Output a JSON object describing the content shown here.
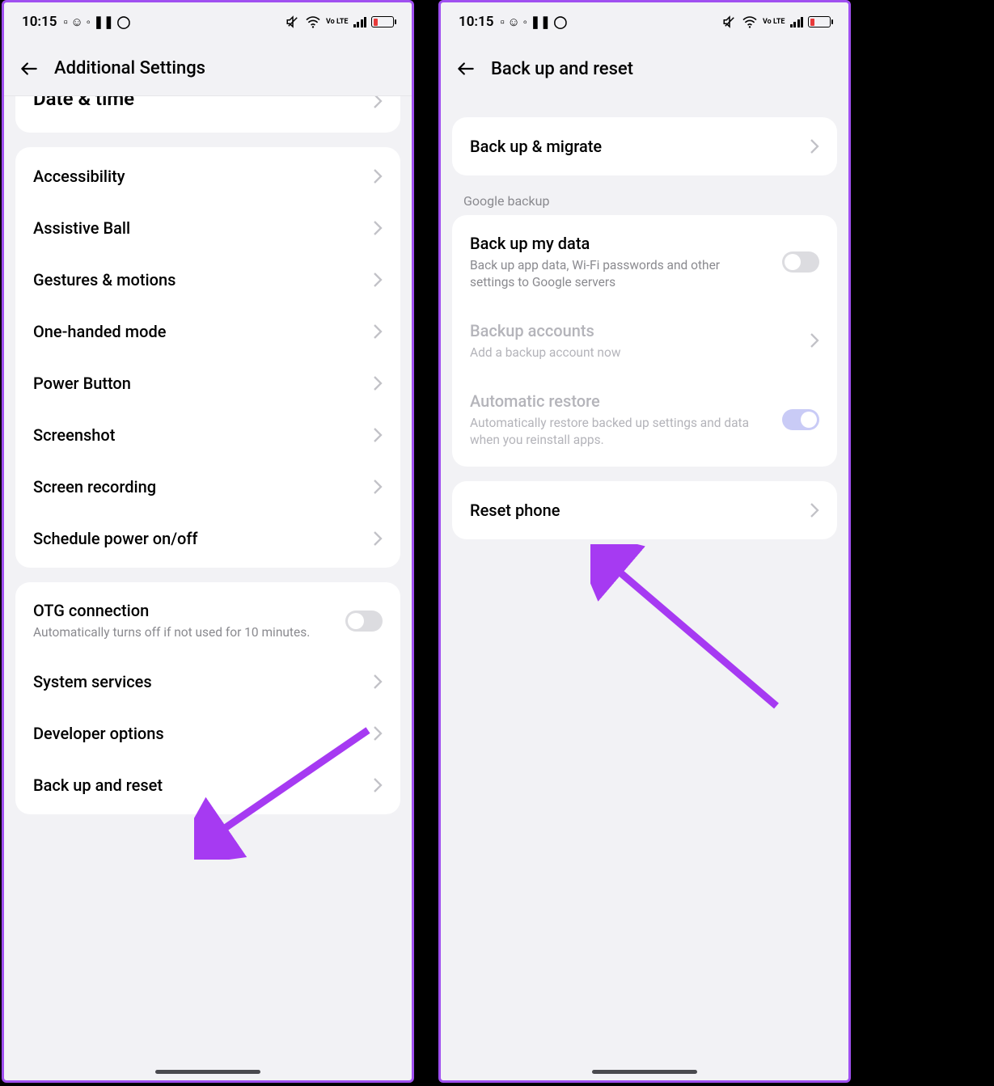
{
  "status": {
    "time": "10:15",
    "volte": "Vo LTE"
  },
  "left": {
    "title": "Additional Settings",
    "partial_item": "Date & time",
    "group1": [
      "Accessibility",
      "Assistive Ball",
      "Gestures & motions",
      "One-handed mode",
      "Power Button",
      "Screenshot",
      "Screen recording",
      "Schedule power on/off"
    ],
    "otg": {
      "title": "OTG connection",
      "sub": "Automatically turns off if not used for 10 minutes."
    },
    "group2": [
      "System services",
      "Developer options",
      "Back up and reset"
    ]
  },
  "right": {
    "title": "Back up and reset",
    "backup_migrate": "Back up & migrate",
    "section_google": "Google backup",
    "backup_my_data": {
      "title": "Back up my data",
      "sub": "Back up app data, Wi-Fi passwords and other settings to Google servers"
    },
    "backup_accounts": {
      "title": "Backup accounts",
      "sub": "Add a backup account now"
    },
    "auto_restore": {
      "title": "Automatic restore",
      "sub": "Automatically restore backed up settings and data when you reinstall apps."
    },
    "reset_phone": "Reset phone"
  }
}
